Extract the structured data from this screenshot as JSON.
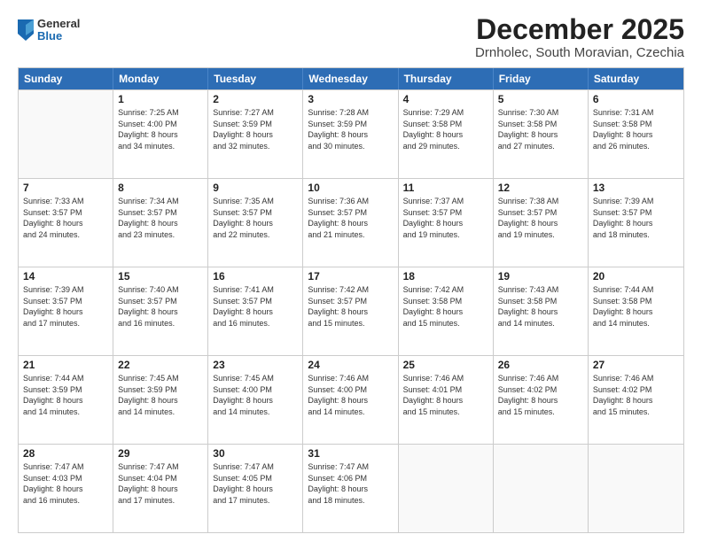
{
  "logo": {
    "general": "General",
    "blue": "Blue"
  },
  "title": "December 2025",
  "subtitle": "Drnholec, South Moravian, Czechia",
  "days_of_week": [
    "Sunday",
    "Monday",
    "Tuesday",
    "Wednesday",
    "Thursday",
    "Friday",
    "Saturday"
  ],
  "weeks": [
    [
      {
        "day": "",
        "info": ""
      },
      {
        "day": "1",
        "info": "Sunrise: 7:25 AM\nSunset: 4:00 PM\nDaylight: 8 hours\nand 34 minutes."
      },
      {
        "day": "2",
        "info": "Sunrise: 7:27 AM\nSunset: 3:59 PM\nDaylight: 8 hours\nand 32 minutes."
      },
      {
        "day": "3",
        "info": "Sunrise: 7:28 AM\nSunset: 3:59 PM\nDaylight: 8 hours\nand 30 minutes."
      },
      {
        "day": "4",
        "info": "Sunrise: 7:29 AM\nSunset: 3:58 PM\nDaylight: 8 hours\nand 29 minutes."
      },
      {
        "day": "5",
        "info": "Sunrise: 7:30 AM\nSunset: 3:58 PM\nDaylight: 8 hours\nand 27 minutes."
      },
      {
        "day": "6",
        "info": "Sunrise: 7:31 AM\nSunset: 3:58 PM\nDaylight: 8 hours\nand 26 minutes."
      }
    ],
    [
      {
        "day": "7",
        "info": "Sunrise: 7:33 AM\nSunset: 3:57 PM\nDaylight: 8 hours\nand 24 minutes."
      },
      {
        "day": "8",
        "info": "Sunrise: 7:34 AM\nSunset: 3:57 PM\nDaylight: 8 hours\nand 23 minutes."
      },
      {
        "day": "9",
        "info": "Sunrise: 7:35 AM\nSunset: 3:57 PM\nDaylight: 8 hours\nand 22 minutes."
      },
      {
        "day": "10",
        "info": "Sunrise: 7:36 AM\nSunset: 3:57 PM\nDaylight: 8 hours\nand 21 minutes."
      },
      {
        "day": "11",
        "info": "Sunrise: 7:37 AM\nSunset: 3:57 PM\nDaylight: 8 hours\nand 19 minutes."
      },
      {
        "day": "12",
        "info": "Sunrise: 7:38 AM\nSunset: 3:57 PM\nDaylight: 8 hours\nand 19 minutes."
      },
      {
        "day": "13",
        "info": "Sunrise: 7:39 AM\nSunset: 3:57 PM\nDaylight: 8 hours\nand 18 minutes."
      }
    ],
    [
      {
        "day": "14",
        "info": "Sunrise: 7:39 AM\nSunset: 3:57 PM\nDaylight: 8 hours\nand 17 minutes."
      },
      {
        "day": "15",
        "info": "Sunrise: 7:40 AM\nSunset: 3:57 PM\nDaylight: 8 hours\nand 16 minutes."
      },
      {
        "day": "16",
        "info": "Sunrise: 7:41 AM\nSunset: 3:57 PM\nDaylight: 8 hours\nand 16 minutes."
      },
      {
        "day": "17",
        "info": "Sunrise: 7:42 AM\nSunset: 3:57 PM\nDaylight: 8 hours\nand 15 minutes."
      },
      {
        "day": "18",
        "info": "Sunrise: 7:42 AM\nSunset: 3:58 PM\nDaylight: 8 hours\nand 15 minutes."
      },
      {
        "day": "19",
        "info": "Sunrise: 7:43 AM\nSunset: 3:58 PM\nDaylight: 8 hours\nand 14 minutes."
      },
      {
        "day": "20",
        "info": "Sunrise: 7:44 AM\nSunset: 3:58 PM\nDaylight: 8 hours\nand 14 minutes."
      }
    ],
    [
      {
        "day": "21",
        "info": "Sunrise: 7:44 AM\nSunset: 3:59 PM\nDaylight: 8 hours\nand 14 minutes."
      },
      {
        "day": "22",
        "info": "Sunrise: 7:45 AM\nSunset: 3:59 PM\nDaylight: 8 hours\nand 14 minutes."
      },
      {
        "day": "23",
        "info": "Sunrise: 7:45 AM\nSunset: 4:00 PM\nDaylight: 8 hours\nand 14 minutes."
      },
      {
        "day": "24",
        "info": "Sunrise: 7:46 AM\nSunset: 4:00 PM\nDaylight: 8 hours\nand 14 minutes."
      },
      {
        "day": "25",
        "info": "Sunrise: 7:46 AM\nSunset: 4:01 PM\nDaylight: 8 hours\nand 15 minutes."
      },
      {
        "day": "26",
        "info": "Sunrise: 7:46 AM\nSunset: 4:02 PM\nDaylight: 8 hours\nand 15 minutes."
      },
      {
        "day": "27",
        "info": "Sunrise: 7:46 AM\nSunset: 4:02 PM\nDaylight: 8 hours\nand 15 minutes."
      }
    ],
    [
      {
        "day": "28",
        "info": "Sunrise: 7:47 AM\nSunset: 4:03 PM\nDaylight: 8 hours\nand 16 minutes."
      },
      {
        "day": "29",
        "info": "Sunrise: 7:47 AM\nSunset: 4:04 PM\nDaylight: 8 hours\nand 17 minutes."
      },
      {
        "day": "30",
        "info": "Sunrise: 7:47 AM\nSunset: 4:05 PM\nDaylight: 8 hours\nand 17 minutes."
      },
      {
        "day": "31",
        "info": "Sunrise: 7:47 AM\nSunset: 4:06 PM\nDaylight: 8 hours\nand 18 minutes."
      },
      {
        "day": "",
        "info": ""
      },
      {
        "day": "",
        "info": ""
      },
      {
        "day": "",
        "info": ""
      }
    ]
  ]
}
